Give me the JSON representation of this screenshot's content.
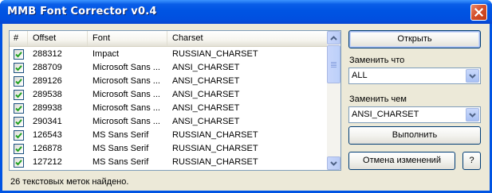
{
  "window": {
    "title": "MMB Font Corrector v0.4"
  },
  "table": {
    "headers": [
      "#",
      "Offset",
      "Font",
      "Charset"
    ],
    "rows": [
      {
        "checked": true,
        "offset": "288312",
        "font": "Impact",
        "charset": "RUSSIAN_CHARSET"
      },
      {
        "checked": true,
        "offset": "288709",
        "font": "Microsoft Sans ...",
        "charset": "ANSI_CHARSET"
      },
      {
        "checked": true,
        "offset": "289126",
        "font": "Microsoft Sans ...",
        "charset": "ANSI_CHARSET"
      },
      {
        "checked": true,
        "offset": "289538",
        "font": "Microsoft Sans ...",
        "charset": "ANSI_CHARSET"
      },
      {
        "checked": true,
        "offset": "289938",
        "font": "Microsoft Sans ...",
        "charset": "ANSI_CHARSET"
      },
      {
        "checked": true,
        "offset": "290341",
        "font": "Microsoft Sans ...",
        "charset": "ANSI_CHARSET"
      },
      {
        "checked": true,
        "offset": "126543",
        "font": "MS Sans Serif",
        "charset": "RUSSIAN_CHARSET"
      },
      {
        "checked": true,
        "offset": "126878",
        "font": "MS Sans Serif",
        "charset": "RUSSIAN_CHARSET"
      },
      {
        "checked": true,
        "offset": "127212",
        "font": "MS Sans Serif",
        "charset": "RUSSIAN_CHARSET"
      }
    ]
  },
  "status": {
    "text": "26 текстовых меток найдено."
  },
  "panel": {
    "open_button": "Открыть",
    "replace_what_label": "Заменить что",
    "replace_what_value": "ALL",
    "replace_with_label": "Заменить чем",
    "replace_with_value": "ANSI_CHARSET",
    "execute_button": "Выполнить",
    "undo_button": "Отмена изменений",
    "help_button": "?"
  }
}
